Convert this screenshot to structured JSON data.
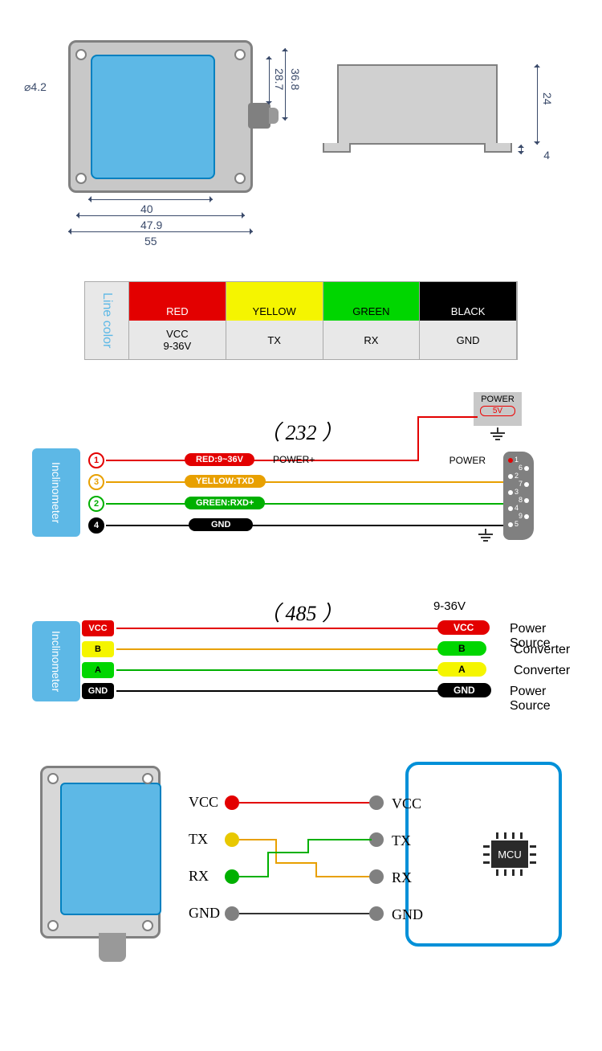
{
  "dimensions": {
    "hole_dia": "⌀4.2",
    "width_inner": "40",
    "width_mid": "47.9",
    "width_outer": "55",
    "conn_h1": "28.7",
    "conn_h2": "36.8",
    "side_height": "24",
    "side_foot": "4"
  },
  "line_color_table": {
    "label": "Line color",
    "cols": [
      {
        "color": "RED",
        "bg": "#e30000",
        "fg": "#fff",
        "func1": "VCC",
        "func2": "9-36V"
      },
      {
        "color": "YELLOW",
        "bg": "#f5f500",
        "fg": "#000",
        "func1": "TX",
        "func2": ""
      },
      {
        "color": "GREEN",
        "bg": "#00d600",
        "fg": "#000",
        "func1": "RX",
        "func2": ""
      },
      {
        "color": "BLACK",
        "bg": "#000",
        "fg": "#fff",
        "func1": "GND",
        "func2": ""
      }
    ]
  },
  "wiring232": {
    "title": "（ 232 ）",
    "sensor": "Inclinometer",
    "power_label": "POWER",
    "power_volt": "5V",
    "power_conn": "POWER",
    "pins": [
      {
        "num": "1",
        "color": "#e30000",
        "label": "RED:9~36V",
        "note": "POWER+"
      },
      {
        "num": "3",
        "color": "#e8a000",
        "label": "YELLOW:TXD",
        "note": ""
      },
      {
        "num": "2",
        "color": "#00b000",
        "label": "GREEN:RXD+",
        "note": ""
      },
      {
        "num": "4",
        "color": "#000",
        "label": "GND",
        "note": ""
      }
    ],
    "db9_pins": [
      "1",
      "2",
      "3",
      "4",
      "5",
      "6",
      "7",
      "8",
      "9"
    ]
  },
  "wiring485": {
    "title": "（ 485 ）",
    "voltage": "9-36V",
    "sensor": "Inclinometer",
    "lines": [
      {
        "tag": "VCC",
        "tagbg": "#e30000",
        "tagfg": "#fff",
        "wire": "#e30000",
        "rtag": "VCC",
        "rbg": "#e30000",
        "rfg": "#fff",
        "desc": "Power Source"
      },
      {
        "tag": "B",
        "tagbg": "#f5f500",
        "tagfg": "#000",
        "wire": "#e8a000",
        "rtag": "B",
        "rbg": "#00d600",
        "rfg": "#000",
        "desc": "Converter"
      },
      {
        "tag": "A",
        "tagbg": "#00d600",
        "tagfg": "#000",
        "wire": "#00b000",
        "rtag": "A",
        "rbg": "#f5f500",
        "rfg": "#000",
        "desc": "Converter"
      },
      {
        "tag": "GND",
        "tagbg": "#000",
        "tagfg": "#fff",
        "wire": "#000",
        "rtag": "GND",
        "rbg": "#000",
        "rfg": "#fff",
        "desc": "Power Source"
      }
    ]
  },
  "mcu": {
    "chip": "MCU",
    "signals": [
      {
        "name": "VCC",
        "color": "#e30000"
      },
      {
        "name": "TX",
        "color": "#e8c800"
      },
      {
        "name": "RX",
        "color": "#00b000"
      },
      {
        "name": "GND",
        "color": "#808080"
      }
    ]
  }
}
